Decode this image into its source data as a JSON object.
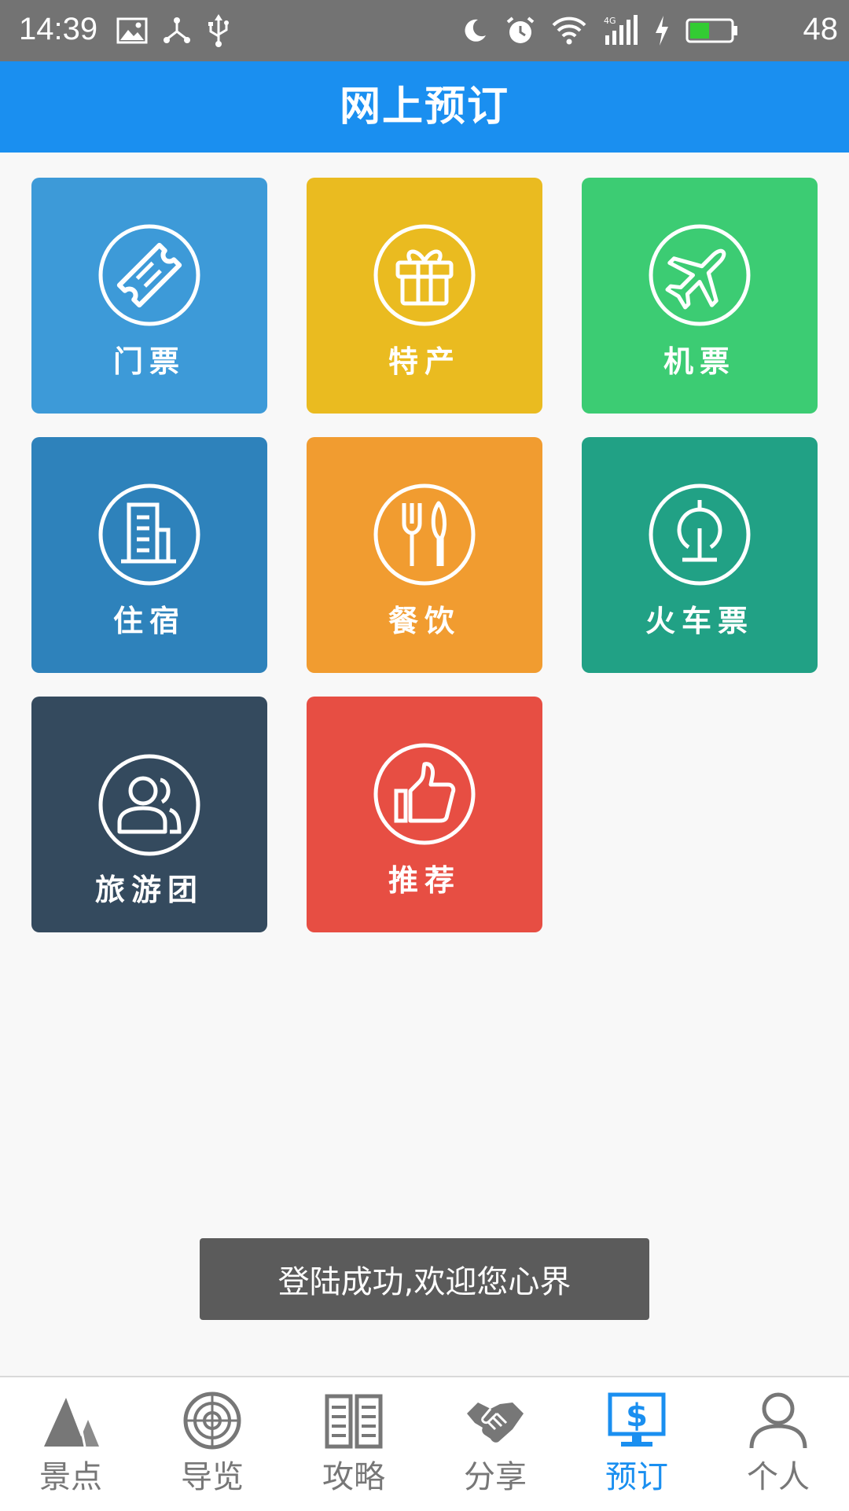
{
  "status_bar": {
    "time": "14:39",
    "network": "4G",
    "battery_level": "48",
    "battery_color": "#33cc33",
    "left_icons": [
      "image-icon",
      "share-hub-icon",
      "usb-icon"
    ],
    "right_icons": [
      "moon-icon",
      "alarm-icon",
      "wifi-icon",
      "signal-icon",
      "charging-icon",
      "battery-icon"
    ]
  },
  "header": {
    "title": "网上预订"
  },
  "tiles": [
    {
      "label": "门票",
      "icon": "ticket-icon",
      "color": "#3d9ad8"
    },
    {
      "label": "特产",
      "icon": "gift-icon",
      "color": "#eabb20"
    },
    {
      "label": "机票",
      "icon": "airplane-icon",
      "color": "#3ccc73"
    },
    {
      "label": "住宿",
      "icon": "building-icon",
      "color": "#2e82bb"
    },
    {
      "label": "餐饮",
      "icon": "fork-knife-icon",
      "color": "#f19c30"
    },
    {
      "label": "火车票",
      "icon": "railway-icon",
      "color": "#21a185"
    },
    {
      "label": "旅游团",
      "icon": "group-icon",
      "color": "#344a5e"
    },
    {
      "label": "推荐",
      "icon": "thumbs-up-icon",
      "color": "#e74e43"
    }
  ],
  "toast": {
    "message": "登陆成功,欢迎您心界"
  },
  "bottom_nav": {
    "active_color": "#1a8ff0",
    "inactive_color": "#777777",
    "active_index": 4,
    "items": [
      {
        "label": "景点",
        "icon": "mountain-icon"
      },
      {
        "label": "导览",
        "icon": "radar-icon"
      },
      {
        "label": "攻略",
        "icon": "book-icon"
      },
      {
        "label": "分享",
        "icon": "handshake-icon"
      },
      {
        "label": "预订",
        "icon": "dollar-monitor-icon"
      },
      {
        "label": "个人",
        "icon": "person-icon"
      }
    ]
  }
}
